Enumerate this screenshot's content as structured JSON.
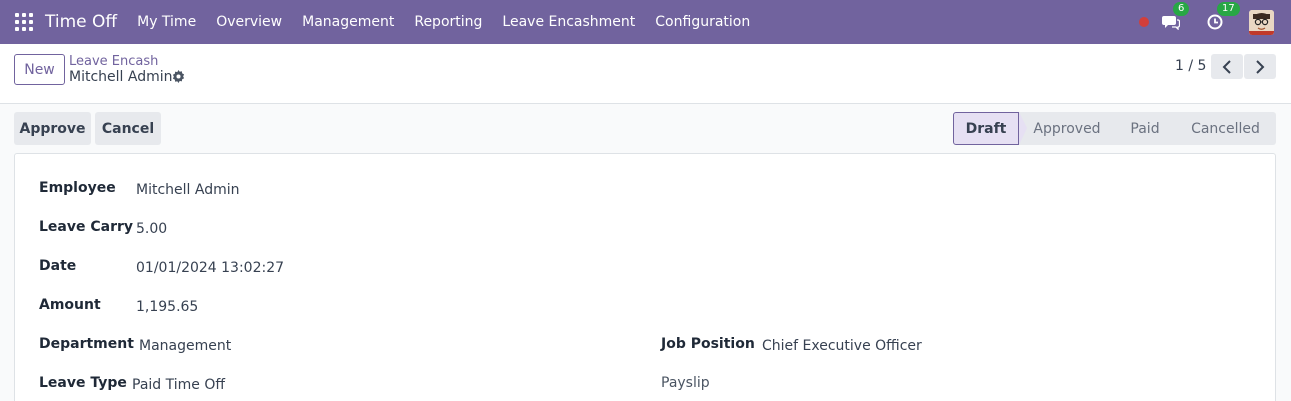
{
  "navbar": {
    "app_title": "Time Off",
    "menu": [
      "My Time",
      "Overview",
      "Management",
      "Reporting",
      "Leave Encashment",
      "Configuration"
    ],
    "messages_count": "6",
    "activities_count": "17"
  },
  "control": {
    "new_label": "New",
    "breadcrumb_parent": "Leave Encash",
    "breadcrumb_current": "Mitchell Admin",
    "pager": "1 / 5"
  },
  "statusbar": {
    "approve_label": "Approve",
    "cancel_label": "Cancel",
    "stages": [
      "Draft",
      "Approved",
      "Paid",
      "Cancelled"
    ],
    "active_stage": "Draft"
  },
  "form": {
    "employee_label": "Employee",
    "employee_value": "Mitchell Admin",
    "leave_carry_label": "Leave Carry",
    "leave_carry_value": "5.00",
    "date_label": "Date",
    "date_value": "01/01/2024 13:02:27",
    "amount_label": "Amount",
    "amount_value": "1,195.65",
    "department_label": "Department",
    "department_value": "Management",
    "job_position_label": "Job Position",
    "job_position_value": "Chief Executive Officer",
    "leave_type_label": "Leave Type",
    "leave_type_value": "Paid Time Off",
    "payslip_label": "Payslip"
  },
  "colors": {
    "brand": "#71639e",
    "badge": "#28a745",
    "recording": "#d23f3a"
  }
}
